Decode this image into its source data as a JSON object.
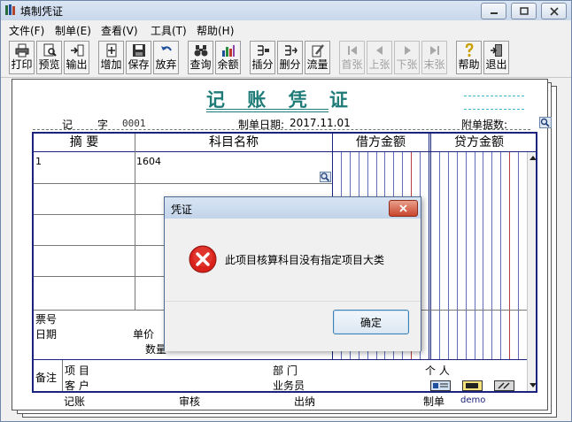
{
  "window": {
    "title": "填制凭证",
    "controls": [
      "minimize-icon",
      "maximize-icon",
      "close-icon"
    ]
  },
  "menu": [
    "文件(F)",
    "制单(E)",
    "查看(V)",
    "工具(T)",
    "帮助(H)"
  ],
  "toolbar": [
    {
      "label": "打印",
      "icon": "printer-icon",
      "enabled": true
    },
    {
      "label": "预览",
      "icon": "preview-icon",
      "enabled": true
    },
    {
      "label": "输出",
      "icon": "export-icon",
      "enabled": true
    },
    {
      "label": "增加",
      "icon": "add-icon",
      "enabled": true
    },
    {
      "label": "保存",
      "icon": "save-icon",
      "enabled": true
    },
    {
      "label": "放弃",
      "icon": "undo-icon",
      "enabled": true
    },
    {
      "label": "查询",
      "icon": "binoculars-icon",
      "enabled": true
    },
    {
      "label": "余额",
      "icon": "balance-chart-icon",
      "enabled": true
    },
    {
      "label": "插分",
      "icon": "insert-row-icon",
      "enabled": true
    },
    {
      "label": "删分",
      "icon": "delete-row-icon",
      "enabled": true
    },
    {
      "label": "流量",
      "icon": "cashflow-icon",
      "enabled": true
    },
    {
      "label": "首张",
      "icon": "first-icon",
      "enabled": false
    },
    {
      "label": "上张",
      "icon": "prev-icon",
      "enabled": false
    },
    {
      "label": "下张",
      "icon": "next-icon",
      "enabled": false
    },
    {
      "label": "末张",
      "icon": "last-icon",
      "enabled": false
    },
    {
      "label": "帮助",
      "icon": "help-icon",
      "enabled": true
    },
    {
      "label": "退出",
      "icon": "exit-icon",
      "enabled": true
    }
  ],
  "voucher": {
    "title": "记 账 凭 证",
    "type_label": "记",
    "number_label": "字",
    "number": "0001",
    "date_label": "制单日期:",
    "date": "2017.11.01",
    "attachments_label": "附单据数:",
    "columns": {
      "summary": "摘 要",
      "account": "科目名称",
      "debit": "借方金额",
      "credit": "贷方金额"
    },
    "rows": [
      {
        "summary": "1",
        "account": "1604"
      },
      {
        "summary": "",
        "account": ""
      },
      {
        "summary": "",
        "account": ""
      },
      {
        "summary": "",
        "account": ""
      },
      {
        "summary": "",
        "account": ""
      }
    ],
    "detail": {
      "ticket_no": "票号",
      "date": "日期",
      "unit_price": "单价",
      "quantity": "数量"
    },
    "notes": {
      "label": "备注",
      "project": "项  目",
      "customer": "客  户",
      "department": "部  门",
      "salesperson": "业务员",
      "person": "个  人"
    },
    "footer": {
      "bookkeeping": "记账",
      "audit": "审核",
      "cashier": "出纳",
      "maker": "制单",
      "maker_name": "demo"
    }
  },
  "dialog": {
    "title": "凭证",
    "message": "此项目核算科目没有指定项目大类",
    "ok": "确定",
    "icon": "error-icon"
  },
  "colors": {
    "title_teal": "#1e7b78",
    "grid_navy": "#1a237e",
    "amount_blue_line": "#2c3ea8",
    "amount_red_line": "#b02a2a",
    "error_red": "#d9221c"
  }
}
